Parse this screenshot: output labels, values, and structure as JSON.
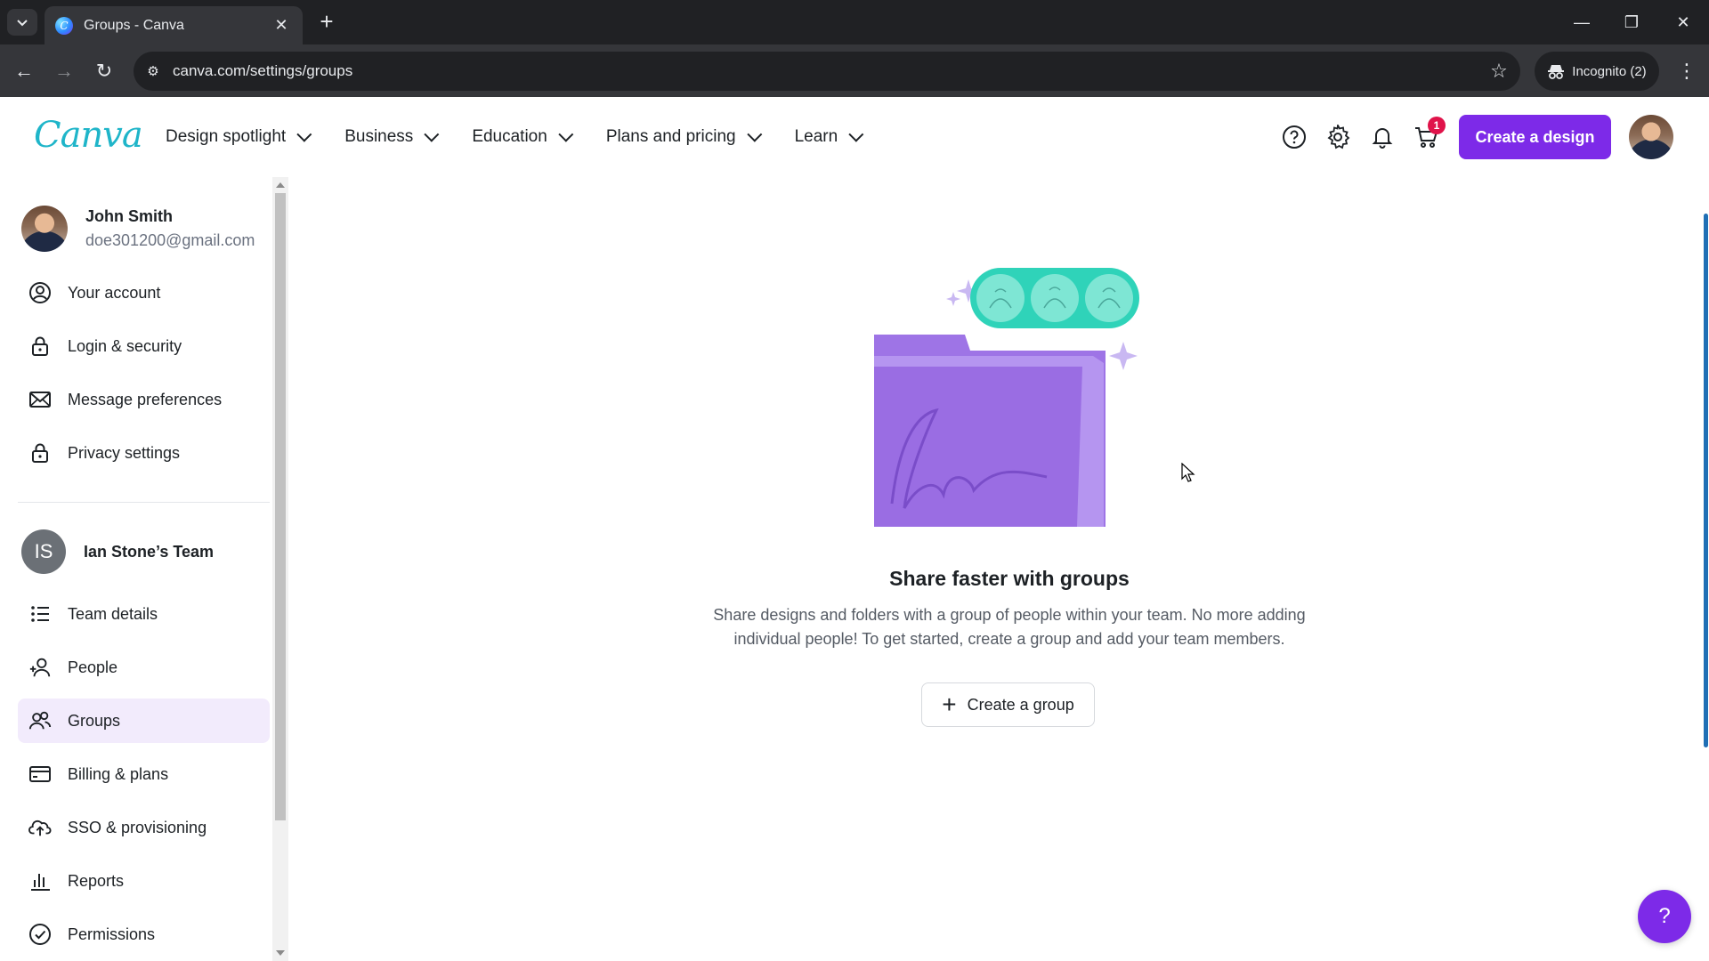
{
  "browser": {
    "tab_title": "Groups - Canva",
    "url": "canva.com/settings/groups",
    "incognito_label": "Incognito (2)"
  },
  "header": {
    "logo": "Canva",
    "nav": [
      {
        "label": "Design spotlight"
      },
      {
        "label": "Business"
      },
      {
        "label": "Education"
      },
      {
        "label": "Plans and pricing"
      },
      {
        "label": "Learn"
      }
    ],
    "cart_count": "1",
    "create_button": "Create a design"
  },
  "sidebar": {
    "user": {
      "name": "John Smith",
      "email": "doe301200@gmail.com"
    },
    "account_items": [
      {
        "label": "Your account",
        "icon": "user-circle-icon"
      },
      {
        "label": "Login & security",
        "icon": "lock-icon"
      },
      {
        "label": "Message preferences",
        "icon": "mail-icon"
      },
      {
        "label": "Privacy settings",
        "icon": "lock-icon"
      }
    ],
    "team": {
      "initials": "IS",
      "name": "Ian Stone’s Team"
    },
    "team_items": [
      {
        "label": "Team details",
        "icon": "list-icon"
      },
      {
        "label": "People",
        "icon": "add-person-icon"
      },
      {
        "label": "Groups",
        "icon": "group-icon",
        "active": true
      },
      {
        "label": "Billing & plans",
        "icon": "credit-card-icon"
      },
      {
        "label": "SSO & provisioning",
        "icon": "cloud-upload-icon"
      },
      {
        "label": "Reports",
        "icon": "bar-chart-icon"
      },
      {
        "label": "Permissions",
        "icon": "check-circle-icon"
      }
    ]
  },
  "main": {
    "title": "Share faster with groups",
    "description_line1": "Share designs and folders with a group of people within your team. No more adding",
    "description_line2": "individual people! To get started, create a group and add your team members.",
    "create_group_button": "Create a group"
  },
  "help_fab": "?",
  "colors": {
    "accent": "#7d2ae8",
    "logo": "#1fb5c9",
    "active_bg": "#f2ebfc",
    "badge": "#e0134a"
  }
}
